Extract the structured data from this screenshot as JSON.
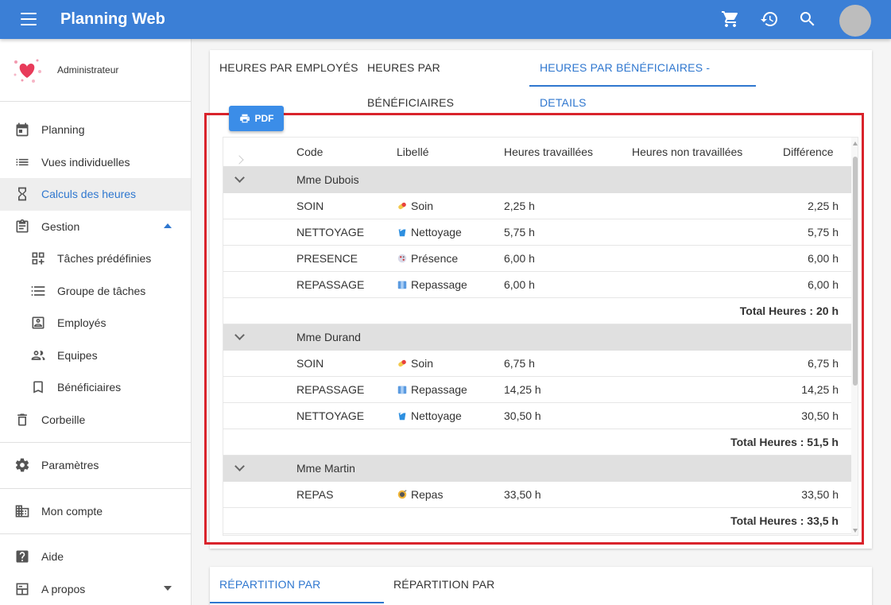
{
  "app": {
    "title": "Planning Web"
  },
  "user": {
    "name": "Administrateur"
  },
  "sidebar": {
    "items": [
      {
        "label": "Planning",
        "icon": "calendar-icon"
      },
      {
        "label": "Vues individuelles",
        "icon": "list-icon"
      },
      {
        "label": "Calculs des heures",
        "icon": "hourglass-icon"
      },
      {
        "label": "Gestion",
        "icon": "clipboard-icon"
      },
      {
        "label": "Tâches prédéfinies",
        "icon": "grid-add-icon"
      },
      {
        "label": "Groupe de tâches",
        "icon": "list-numbered-icon"
      },
      {
        "label": "Employés",
        "icon": "badge-icon"
      },
      {
        "label": "Equipes",
        "icon": "people-icon"
      },
      {
        "label": "Bénéficiaires",
        "icon": "bookmark-icon"
      },
      {
        "label": "Corbeille",
        "icon": "trash-icon"
      },
      {
        "label": "Paramètres",
        "icon": "gear-icon"
      },
      {
        "label": "Mon compte",
        "icon": "building-icon"
      },
      {
        "label": "Aide",
        "icon": "help-icon"
      },
      {
        "label": "A propos",
        "icon": "info-board-icon"
      }
    ]
  },
  "tabs": [
    {
      "label": "HEURES PAR EMPLOYÉS"
    },
    {
      "label": "HEURES PAR BÉNÉFICIAIRES"
    },
    {
      "label": "HEURES PAR BÉNÉFICIAIRES - DETAILS"
    }
  ],
  "pdf": {
    "label": "PDF"
  },
  "table": {
    "headers": {
      "code": "Code",
      "libelle": "Libellé",
      "worked": "Heures travaillées",
      "not_worked": "Heures non travaillées",
      "diff": "Différence"
    },
    "groups": [
      {
        "name": "Mme Dubois",
        "rows": [
          {
            "code": "SOIN",
            "libelle": "Soin",
            "icon": "soin-icon",
            "worked": "2,25 h",
            "diff": "2,25 h"
          },
          {
            "code": "NETTOYAGE",
            "libelle": "Nettoyage",
            "icon": "nettoyage-icon",
            "worked": "5,75 h",
            "diff": "5,75 h"
          },
          {
            "code": "PRESENCE",
            "libelle": "Présence",
            "icon": "presence-icon",
            "worked": "6,00 h",
            "diff": "6,00 h"
          },
          {
            "code": "REPASSAGE",
            "libelle": "Repassage",
            "icon": "repassage-icon",
            "worked": "6,00 h",
            "diff": "6,00 h"
          }
        ],
        "total": "Total Heures : 20 h"
      },
      {
        "name": "Mme Durand",
        "rows": [
          {
            "code": "SOIN",
            "libelle": "Soin",
            "icon": "soin-icon",
            "worked": "6,75 h",
            "diff": "6,75 h"
          },
          {
            "code": "REPASSAGE",
            "libelle": "Repassage",
            "icon": "repassage-icon",
            "worked": "14,25 h",
            "diff": "14,25 h"
          },
          {
            "code": "NETTOYAGE",
            "libelle": "Nettoyage",
            "icon": "nettoyage-icon",
            "worked": "30,50 h",
            "diff": "30,50 h"
          }
        ],
        "total": "Total Heures : 51,5 h"
      },
      {
        "name": "Mme Martin",
        "rows": [
          {
            "code": "REPAS",
            "libelle": "Repas",
            "icon": "repas-icon",
            "worked": "33,50 h",
            "diff": "33,50 h"
          }
        ],
        "total": "Total Heures : 33,5 h"
      }
    ]
  },
  "tabs2": [
    {
      "label": "RÉPARTITION PAR ACTIVITÉS"
    },
    {
      "label": "RÉPARTITION PAR BÉNÉFICIAIRES"
    }
  ],
  "colors": {
    "primary": "#3b7fd6",
    "accent": "#2f77cf",
    "highlight": "#d9232b"
  }
}
